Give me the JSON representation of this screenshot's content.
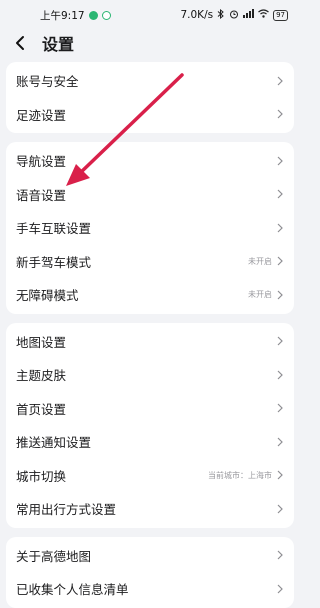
{
  "status_bar": {
    "time": "上午9:17",
    "net_speed": "7.0K/s",
    "battery": "97"
  },
  "header": {
    "title": "设置"
  },
  "groups": [
    {
      "items": [
        {
          "label": "账号与安全",
          "value": ""
        },
        {
          "label": "足迹设置",
          "value": ""
        }
      ]
    },
    {
      "items": [
        {
          "label": "导航设置",
          "value": ""
        },
        {
          "label": "语音设置",
          "value": ""
        },
        {
          "label": "手车互联设置",
          "value": ""
        },
        {
          "label": "新手驾车模式",
          "value": "未开启"
        },
        {
          "label": "无障碍模式",
          "value": "未开启"
        }
      ]
    },
    {
      "items": [
        {
          "label": "地图设置",
          "value": ""
        },
        {
          "label": "主题皮肤",
          "value": ""
        },
        {
          "label": "首页设置",
          "value": ""
        },
        {
          "label": "推送通知设置",
          "value": ""
        },
        {
          "label": "城市切换",
          "value": "当前城市：上海市"
        },
        {
          "label": "常用出行方式设置",
          "value": ""
        }
      ]
    },
    {
      "items": [
        {
          "label": "关于高德地图",
          "value": ""
        },
        {
          "label": "已收集个人信息清单",
          "value": ""
        }
      ]
    }
  ],
  "colors": {
    "annotation_arrow": "#d9204a",
    "background": "#f2f3f6"
  }
}
